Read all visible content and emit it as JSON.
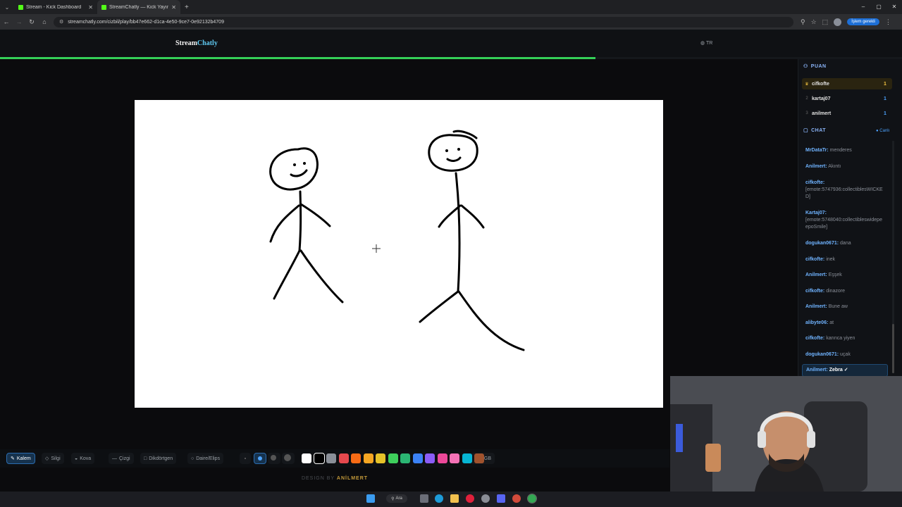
{
  "browser": {
    "tabs": [
      {
        "title": "Stream - Kick Dashboard",
        "favicon_color": "#53fc18",
        "active": false
      },
      {
        "title": "StreamChatly — Kick Yayıncıla",
        "favicon_color": "#53fc18",
        "active": true
      }
    ],
    "url": "streamchatly.com/cizbil/play/bb47e662-d1ca-4e50-9ce7-0e92132b4709",
    "update_label": "İşlem gerekli"
  },
  "app": {
    "logo_main": "Stream",
    "logo_accent": "Chatly",
    "language": "TR",
    "round_progress": 0.66
  },
  "scoreboard": {
    "title": "PUAN",
    "rows": [
      {
        "rank": "♛",
        "name": "cifkofte",
        "points": "1"
      },
      {
        "rank": "2",
        "name": "kartaj07",
        "points": "1"
      },
      {
        "rank": "3",
        "name": "anilmert",
        "points": "1"
      }
    ]
  },
  "chat": {
    "title": "CHAT",
    "live_label": "Canlı",
    "messages": [
      {
        "user": "MrDataTr:",
        "text": "menderes"
      },
      {
        "user": "Anilmert:",
        "text": "Akıntı"
      },
      {
        "user": "cifkofte:",
        "text": "[emote:5747936:collectiblesWICKED]"
      },
      {
        "user": "Kartaj07:",
        "text": "[emote:5748040:collectibleswidepeepoSmile]"
      },
      {
        "user": "dogukan0671:",
        "text": "dana"
      },
      {
        "user": "cifkofte:",
        "text": "inek"
      },
      {
        "user": "Anilmert:",
        "text": "Eşşek"
      },
      {
        "user": "cifkofte:",
        "text": "dinazore"
      },
      {
        "user": "Anilmert:",
        "text": "Bune aw"
      },
      {
        "user": "alibyte06:",
        "text": "at"
      },
      {
        "user": "cifkofte:",
        "text": "karınca yiyen"
      },
      {
        "user": "dogukan0671:",
        "text": "uçak"
      },
      {
        "user": "Anilmert:",
        "text": "Zebra ✓"
      }
    ]
  },
  "tools": {
    "pen": "Kalem",
    "eraser": "Silgi",
    "bucket": "Kova",
    "line": "Çizgi",
    "rect": "Dikdörtgen",
    "ellipse": "Daire/Elips",
    "rgb": "RGB"
  },
  "palette": [
    "#ffffff",
    "#000000",
    "#8a8f98",
    "#e5484d",
    "#f76b15",
    "#f5a623",
    "#e6c229",
    "#3ecf5c",
    "#2bb673",
    "#3b82f6",
    "#8b5cf6",
    "#ec4899",
    "#f472b6",
    "#06b6d4",
    "#a0522d"
  ],
  "footer": {
    "prefix": "DESIGN BY",
    "brand": "ANİLMERT"
  },
  "taskbar": {
    "search_label": "Ara"
  }
}
